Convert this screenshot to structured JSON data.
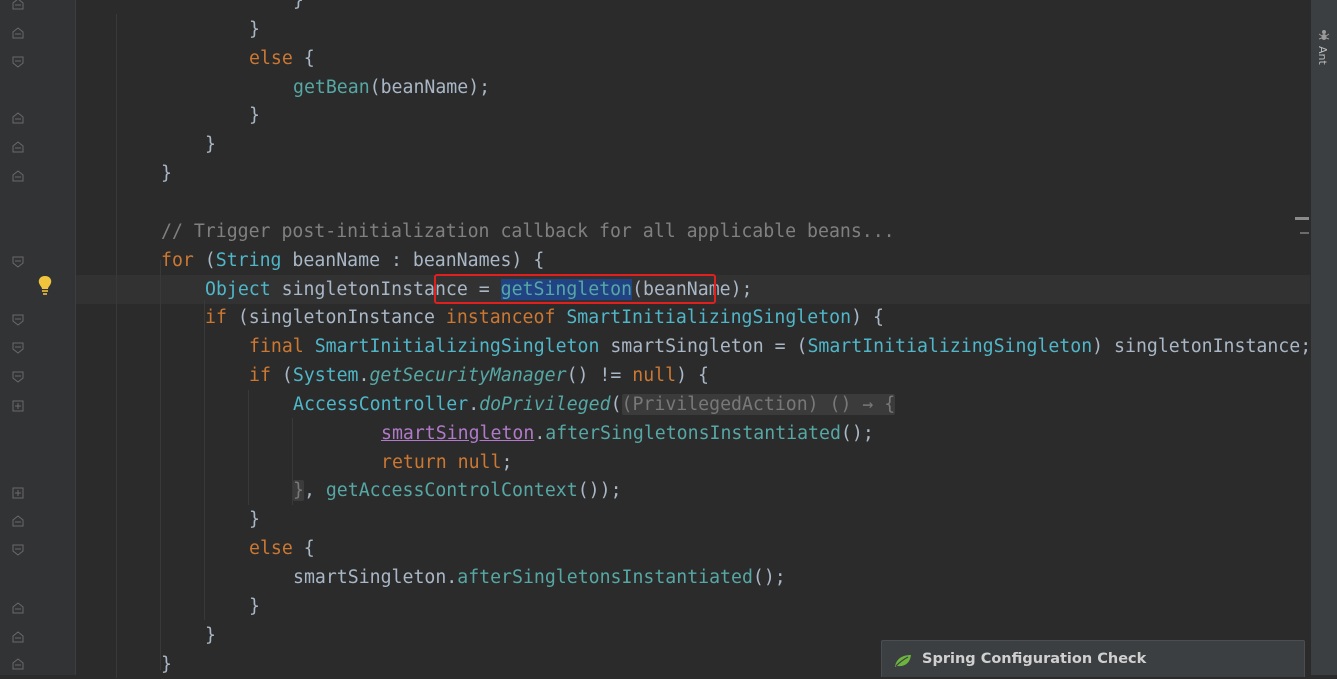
{
  "editor": {
    "lines": [
      {
        "tokens": [
          {
            "t": "}",
            "c": "pl"
          }
        ]
      },
      {
        "tokens": [
          {
            "t": "}",
            "c": "pl"
          }
        ]
      },
      {
        "tokens": [
          {
            "t": "else",
            "c": "kw"
          },
          {
            "t": " {",
            "c": "pl"
          }
        ]
      },
      {
        "tokens": [
          {
            "t": "getBean",
            "c": "fn"
          },
          {
            "t": "(beanName);",
            "c": "pl"
          }
        ]
      },
      {
        "tokens": [
          {
            "t": "}",
            "c": "pl"
          }
        ]
      },
      {
        "tokens": [
          {
            "t": "}",
            "c": "pl"
          }
        ]
      },
      {
        "tokens": [
          {
            "t": "}",
            "c": "pl"
          }
        ]
      },
      {
        "tokens": []
      },
      {
        "tokens": [
          {
            "t": "// Trigger post-initialization callback for all applicable beans...",
            "c": "cm"
          }
        ]
      },
      {
        "tokens": [
          {
            "t": "for",
            "c": "kw"
          },
          {
            "t": " (",
            "c": "pl"
          },
          {
            "t": "String",
            "c": "cls"
          },
          {
            "t": " beanName : beanNames) {",
            "c": "pl"
          }
        ]
      },
      {
        "tokens": [
          {
            "t": "Object",
            "c": "cls"
          },
          {
            "t": " singletonInstance = ",
            "c": "pl"
          },
          {
            "t": "getSin",
            "c": "fn sel"
          },
          {
            "t": "caret",
            "c": "caret"
          },
          {
            "t": "gleton",
            "c": "fn sel"
          },
          {
            "t": "(beanName);",
            "c": "pl"
          }
        ]
      },
      {
        "tokens": [
          {
            "t": "if",
            "c": "kw"
          },
          {
            "t": " (singletonInstance ",
            "c": "pl"
          },
          {
            "t": "instanceof",
            "c": "kw"
          },
          {
            "t": " ",
            "c": "pl"
          },
          {
            "t": "SmartInitializingSingleton",
            "c": "cls"
          },
          {
            "t": ") {",
            "c": "pl"
          }
        ]
      },
      {
        "tokens": [
          {
            "t": "final",
            "c": "kw"
          },
          {
            "t": " ",
            "c": "pl"
          },
          {
            "t": "SmartInitializingSingleton",
            "c": "cls"
          },
          {
            "t": " smartSingleton = (",
            "c": "pl"
          },
          {
            "t": "SmartInitializingSingleton",
            "c": "cls"
          },
          {
            "t": ") singletonInstance;",
            "c": "pl"
          }
        ]
      },
      {
        "tokens": [
          {
            "t": "if",
            "c": "kw"
          },
          {
            "t": " (",
            "c": "pl"
          },
          {
            "t": "System",
            "c": "cls"
          },
          {
            "t": ".",
            "c": "pl"
          },
          {
            "t": "getSecurityManager",
            "c": "fni"
          },
          {
            "t": "() != ",
            "c": "pl"
          },
          {
            "t": "null",
            "c": "kw"
          },
          {
            "t": ") {",
            "c": "pl"
          }
        ]
      },
      {
        "tokens": [
          {
            "t": "AccessController",
            "c": "cls"
          },
          {
            "t": ".",
            "c": "pl"
          },
          {
            "t": "doPrivileged",
            "c": "fni"
          },
          {
            "t": "(",
            "c": "pl"
          },
          {
            "t": "(PrivilegedAction) () → {",
            "c": "hint"
          }
        ]
      },
      {
        "tokens": [
          {
            "t": "smartSingleton",
            "c": "purp"
          },
          {
            "t": ".",
            "c": "pl"
          },
          {
            "t": "afterSingletonsInstantiated",
            "c": "fn"
          },
          {
            "t": "();",
            "c": "pl"
          }
        ]
      },
      {
        "tokens": [
          {
            "t": "return",
            "c": "kw"
          },
          {
            "t": " ",
            "c": "pl"
          },
          {
            "t": "null",
            "c": "kw"
          },
          {
            "t": ";",
            "c": "pl"
          }
        ]
      },
      {
        "tokens": [
          {
            "t": "}",
            "c": "hint"
          },
          {
            "t": ", ",
            "c": "pl"
          },
          {
            "t": "getAccessControlContext",
            "c": "fn"
          },
          {
            "t": "());",
            "c": "pl"
          }
        ]
      },
      {
        "tokens": [
          {
            "t": "}",
            "c": "pl"
          }
        ]
      },
      {
        "tokens": [
          {
            "t": "else",
            "c": "kw"
          },
          {
            "t": " {",
            "c": "pl"
          }
        ]
      },
      {
        "tokens": [
          {
            "t": "smartSingleton.",
            "c": "pl"
          },
          {
            "t": "afterSingletonsInstantiated",
            "c": "fn"
          },
          {
            "t": "();",
            "c": "pl"
          }
        ]
      },
      {
        "tokens": [
          {
            "t": "}",
            "c": "pl"
          }
        ]
      },
      {
        "tokens": [
          {
            "t": "}",
            "c": "pl"
          }
        ]
      },
      {
        "tokens": [
          {
            "t": "}",
            "c": "pl"
          }
        ]
      }
    ]
  },
  "tool_window": {
    "label": "Ant"
  },
  "notification": {
    "title": "Spring Configuration Check"
  },
  "colors": {
    "background": "#2b2b2b",
    "keyword": "#cc7832",
    "method": "#56a8a5",
    "class": "#4fb7c9",
    "comment": "#808080",
    "highlight_box": "#e0201e",
    "selection": "#214283"
  }
}
